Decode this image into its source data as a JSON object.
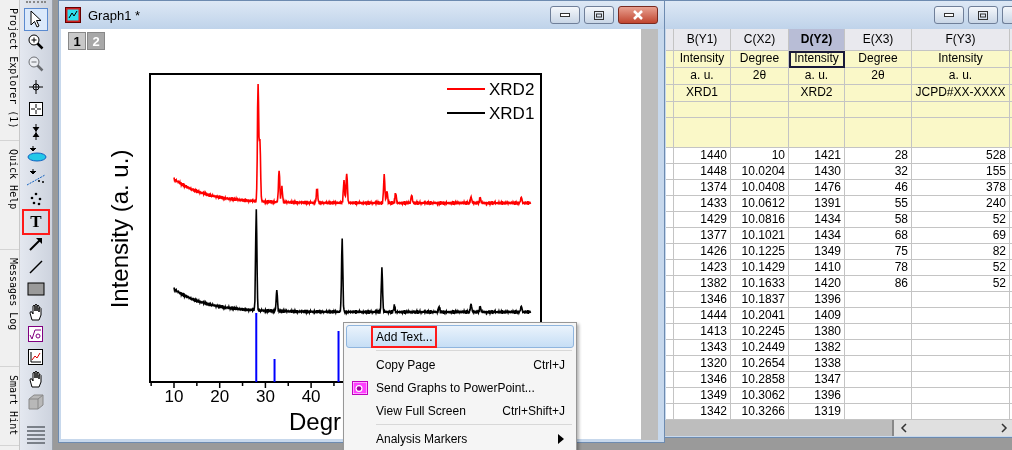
{
  "dock_tabs": [
    "Project Explorer (1)",
    "Quick Help",
    "Messages Log",
    "Smart Hint"
  ],
  "tools": [
    {
      "kind": "pointer",
      "selected": true,
      "highlighted": false
    },
    {
      "kind": "zoom-in",
      "selected": false,
      "highlighted": false
    },
    {
      "kind": "zoom-out",
      "selected": false,
      "highlighted": false
    },
    {
      "kind": "crosshair",
      "selected": false,
      "highlighted": false
    },
    {
      "kind": "region",
      "selected": false,
      "highlighted": false
    },
    {
      "kind": "reader",
      "selected": false,
      "highlighted": false
    },
    {
      "kind": "ellipse",
      "selected": false,
      "highlighted": false
    },
    {
      "kind": "fit",
      "selected": false,
      "highlighted": false
    },
    {
      "kind": "dots",
      "selected": false,
      "highlighted": false
    },
    {
      "kind": "text",
      "glyph": "T",
      "selected": false,
      "highlighted": true
    },
    {
      "kind": "arrow",
      "selected": false,
      "highlighted": false
    },
    {
      "kind": "line",
      "selected": false,
      "highlighted": false
    },
    {
      "kind": "rectangle",
      "selected": false,
      "highlighted": false
    },
    {
      "kind": "hand",
      "selected": false,
      "highlighted": false
    },
    {
      "kind": "formula",
      "selected": false,
      "highlighted": false
    },
    {
      "kind": "graph",
      "selected": false,
      "highlighted": false
    },
    {
      "kind": "hand",
      "selected": false,
      "highlighted": false
    },
    {
      "kind": "cube",
      "selected": false,
      "highlighted": false
    }
  ],
  "graph_window": {
    "title": "Graph1 *",
    "pages": [
      {
        "label": "1",
        "selected": true
      },
      {
        "label": "2",
        "selected": false
      }
    ],
    "legend": [
      {
        "label": "XRD2",
        "color": "#ff0000"
      },
      {
        "label": "XRD1",
        "color": "#000000"
      }
    ],
    "xticks": [
      "10",
      "20",
      "30",
      "40"
    ],
    "xlabel": "Degr",
    "ylabel": "Intensity (a. u.)"
  },
  "context_menu": {
    "items": [
      {
        "kind": "item",
        "label": "Add Text...",
        "selected": true,
        "highlighted": true
      },
      {
        "kind": "separator"
      },
      {
        "kind": "item",
        "label": "Copy Page",
        "shortcut": "Ctrl+J",
        "selected": false,
        "highlighted": false
      },
      {
        "kind": "item-with-icon",
        "label": "Send Graphs to PowerPoint...",
        "selected": false,
        "highlighted": false
      },
      {
        "kind": "item",
        "label": "View Full Screen",
        "shortcut": "Ctrl+Shift+J",
        "selected": false,
        "highlighted": false
      },
      {
        "kind": "separator"
      },
      {
        "kind": "submenu",
        "label": "Analysis Markers",
        "selected": false,
        "highlighted": false
      }
    ]
  },
  "worksheet": {
    "columns": [
      {
        "label": "B(Y1)",
        "selected": false
      },
      {
        "label": "C(X2)",
        "selected": false
      },
      {
        "label": "D(Y2)",
        "selected": true
      },
      {
        "label": "E(X3)",
        "selected": false
      },
      {
        "label": "F(Y3)",
        "selected": false
      }
    ],
    "header_rows": [
      [
        "Intensity",
        "Degree",
        "Intensity",
        "Degree",
        "Intensity"
      ],
      [
        "a. u.",
        "2θ",
        "a. u.",
        "2θ",
        "a. u."
      ],
      [
        "XRD1",
        null,
        "XRD2",
        null,
        "JCPD#XX-XXXX"
      ]
    ],
    "rows": [
      [
        "1440",
        "10",
        "1421",
        "28",
        "528"
      ],
      [
        "1448",
        "10.0204",
        "1430",
        "32",
        "155"
      ],
      [
        "1374",
        "10.0408",
        "1476",
        "46",
        "378"
      ],
      [
        "1433",
        "10.0612",
        "1391",
        "55",
        "240"
      ],
      [
        "1429",
        "10.0816",
        "1434",
        "58",
        "52"
      ],
      [
        "1377",
        "10.1021",
        "1434",
        "68",
        "69"
      ],
      [
        "1426",
        "10.1225",
        "1349",
        "75",
        "82"
      ],
      [
        "1423",
        "10.1429",
        "1410",
        "78",
        "52"
      ],
      [
        "1382",
        "10.1633",
        "1420",
        "86",
        "52"
      ],
      [
        "1346",
        "10.1837",
        "1396"
      ],
      [
        "1444",
        "10.2041",
        "1409"
      ],
      [
        "1413",
        "10.2245",
        "1380"
      ],
      [
        "1343",
        "10.2449",
        "1382"
      ],
      [
        "1320",
        "10.2654",
        "1338"
      ],
      [
        "1346",
        "10.2858",
        "1347"
      ],
      [
        "1349",
        "10.3062",
        "1396"
      ],
      [
        "1342",
        "10.3266",
        "1319"
      ]
    ]
  }
}
